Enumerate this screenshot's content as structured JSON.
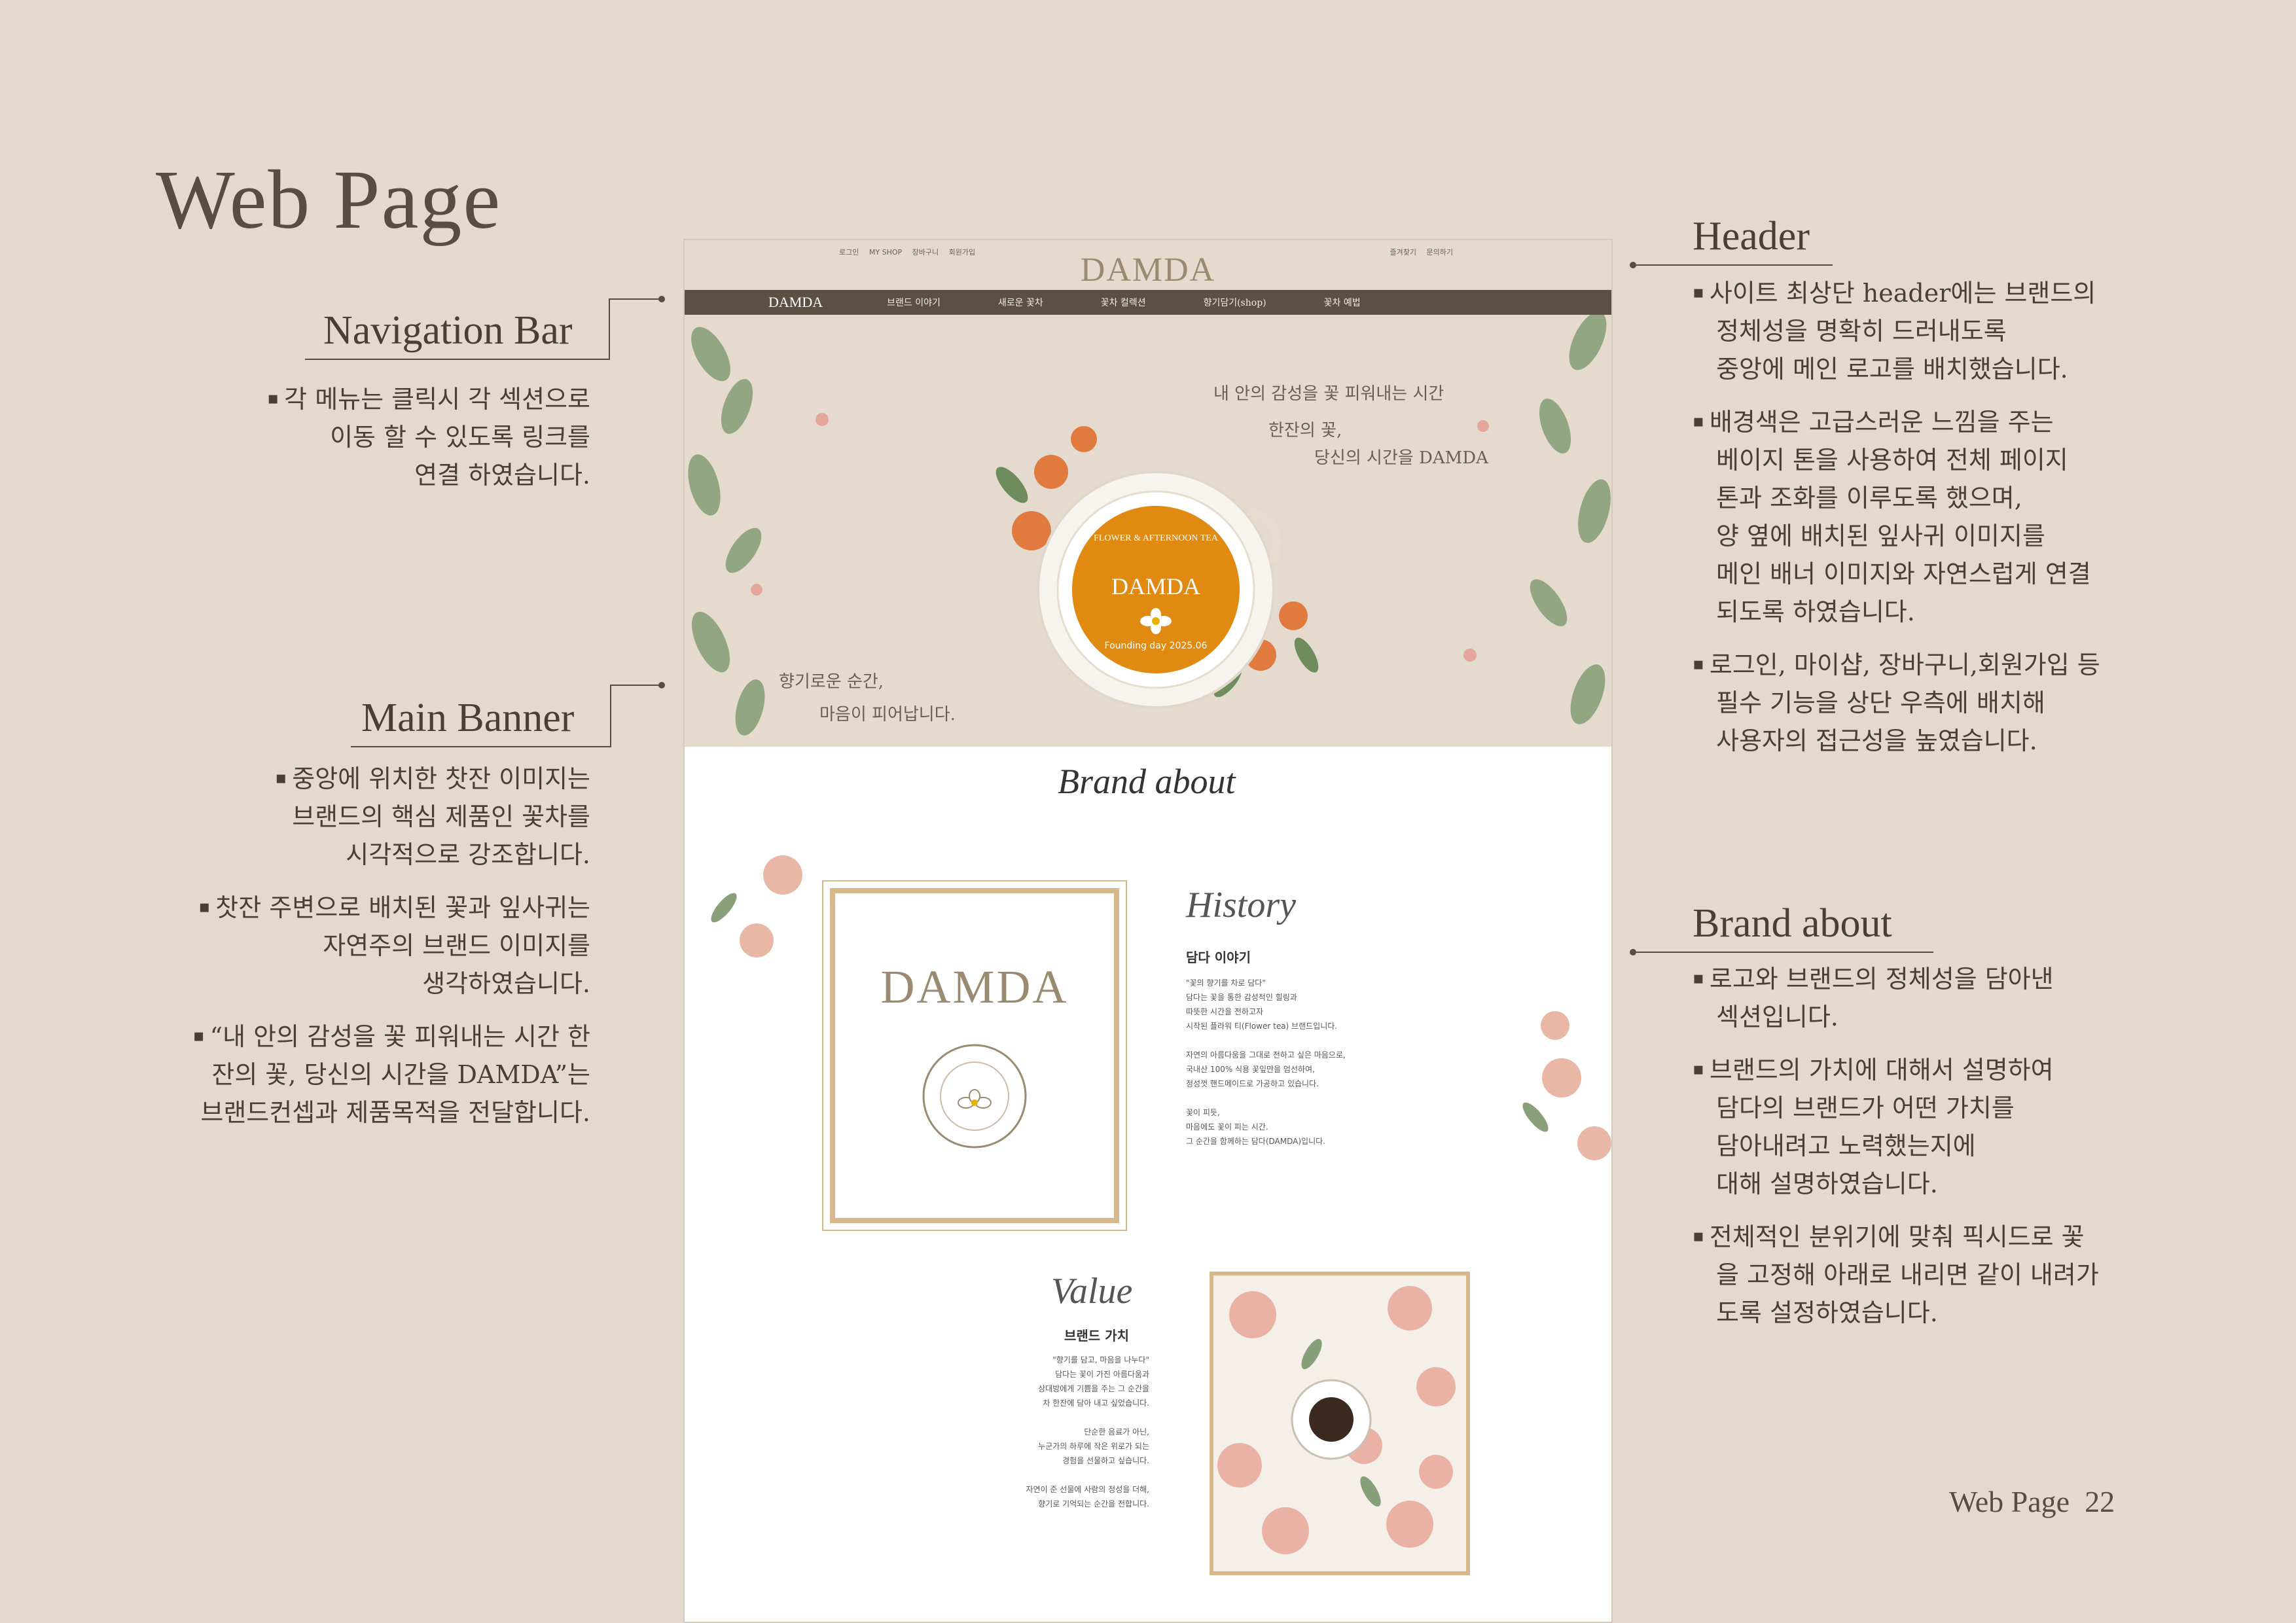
{
  "page": {
    "title": "Web Page",
    "footer": "Web Page  22"
  },
  "navigation_bar": {
    "heading": "Navigation Bar",
    "bullets": [
      "각 메뉴는 클릭시 각 섹션으로\n이동 할 수 있도록 링크를\n연결 하였습니다."
    ]
  },
  "main_banner": {
    "heading": "Main Banner",
    "bullets": [
      "중앙에 위치한 찻잔 이미지는\n브랜드의 핵심 제품인 꽃차를\n시각적으로 강조합니다.",
      "찻잔 주변으로 배치된 꽃과 잎사귀는\n자연주의 브랜드 이미지를\n생각하였습니다.",
      "“내 안의 감성을 꽃 피워내는 시간 한\n잔의 꽃, 당신의 시간을 DAMDA”는\n브랜드컨셉과 제품목적을 전달합니다."
    ]
  },
  "header": {
    "heading": "Header",
    "bullets": [
      "사이트 최상단 header에는 브랜드의\n정체성을 명확히 드러내도록\n중앙에 메인 로고를 배치했습니다.",
      "배경색은 고급스러운 느낌을 주는\n베이지 톤을 사용하여 전체 페이지\n톤과 조화를 이루도록 했으며,\n양 옆에 배치된 잎사귀 이미지를\n메인 배너 이미지와 자연스럽게 연결\n되도록 하였습니다.",
      "로그인, 마이샵, 장바구니,회원가입 등\n필수 기능을 상단 우측에 배치해\n사용자의 접근성을 높였습니다."
    ]
  },
  "brand_about": {
    "heading": "Brand about",
    "bullets": [
      "로고와 브랜드의 정체성을 담아낸\n섹션입니다.",
      "브랜드의 가치에 대해서 설명하여\n담다의 브랜드가 어떤 가치를\n담아내려고 노력했는지에\n대해 설명하였습니다.",
      "전체적인 분위기에 맞춰 픽시드로 꽃\n을 고정해 아래로 내리면 같이 내려가\n도록 설정하였습니다."
    ]
  },
  "mockup": {
    "util_left": [
      "로그인",
      "MY SHOP",
      "장바구니",
      "회원가입"
    ],
    "util_right": [
      "즐겨찾기",
      "문의하기"
    ],
    "logo": "DAMDA",
    "nav_logo": "DAMDA",
    "nav_items": [
      "브랜드 이야기",
      "새로운 꽃차",
      "꽃차 컬렉션",
      "향기담기(shop)",
      "꽃차 예법"
    ],
    "banner": {
      "line1": "내 안의 감성을 꽃 피워내는 시간",
      "line2": "한잔의 꽃,",
      "line3": "당신의 시간을 DAMDA",
      "line4": "향기로운 순간,",
      "line5": "마음이 피어납니다.",
      "badge_top": "FLOWER & AFTERNOON TEA",
      "badge_logo": "DAMDA",
      "badge_bottom": "Founding day 2025.06"
    },
    "about": {
      "title": "Brand about",
      "frame_logo": "DAMDA",
      "history_script": "History",
      "history_title": "담다 이야기",
      "history_text": "\"꽃의 향기를 차로 담다\"\n담다는 꽃을 통한 감성적인 힐링과\n따뜻한 시간을 전하고자\n시작된 플라워 티(Flower tea) 브랜드입니다.\n\n자연의 아름다움을 그대로 전하고 싶은 마음으로,\n국내산 100% 식용 꽃잎만을 엄선하여,\n정성껏 핸드메이드로 가공하고 있습니다.\n\n꽃이 피듯,\n마음에도 꽃이 피는 시간.\n그 순간을 함께하는 담다(DAMDA)입니다.",
      "value_script": "Value",
      "value_title": "브랜드 가치",
      "value_text": "\"향기를 담고, 마음을 나누다\"\n담다는 꽃이 가진 아름다움과\n상대방에게 기쁨을 주는 그 순간을\n차 한잔에 담아 내고 싶었습니다.\n\n단순한 음료가 아닌,\n누군가의 하루에 작은 위로가 되는\n경험을 선물하고 싶습니다.\n\n자연이 준 선물에 사람의 정성을 더해,\n향기로 기억되는 순간을 전합니다."
    }
  },
  "colors": {
    "background": "#e3dacd",
    "text": "#4a3f36",
    "nav": "#5c4f44",
    "gold": "#d6b88a",
    "badge_orange": "#e08a12"
  }
}
